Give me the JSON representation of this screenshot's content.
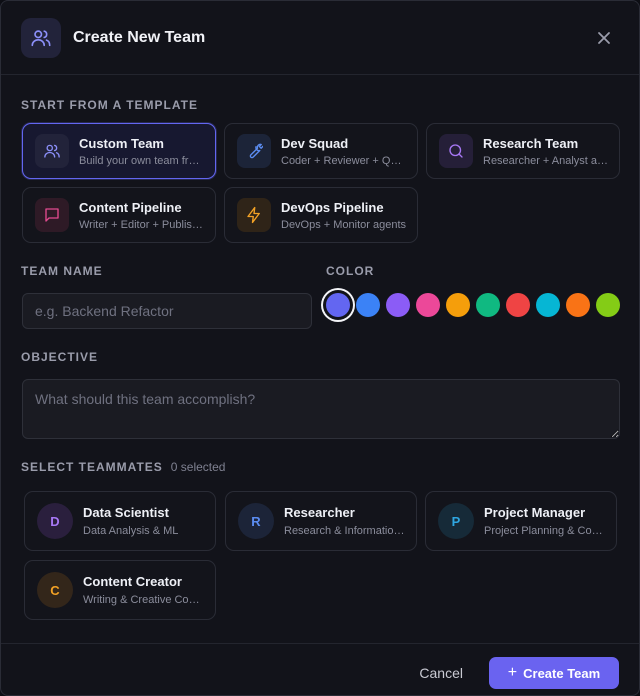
{
  "dialog": {
    "title": "Create New Team",
    "header_icon": "users-icon",
    "close_icon": "close-icon"
  },
  "templates": {
    "label": "START FROM A TEMPLATE",
    "items": [
      {
        "name": "Custom Team",
        "desc": "Build your own team from scratch",
        "icon": "users-icon",
        "color": "#8b8ff8",
        "bg": "#22233a",
        "selected": true
      },
      {
        "name": "Dev Squad",
        "desc": "Coder + Reviewer + QA Tester",
        "icon": "wrench-icon",
        "color": "#5b8cf0",
        "bg": "#1c2438"
      },
      {
        "name": "Research Team",
        "desc": "Researcher + Analyst agents",
        "icon": "search-icon",
        "color": "#a778f5",
        "bg": "#251f38"
      },
      {
        "name": "Content Pipeline",
        "desc": "Writer + Editor + Publisher",
        "icon": "chat-icon",
        "color": "#e24a8f",
        "bg": "#2e1a26"
      },
      {
        "name": "DevOps Pipeline",
        "desc": "DevOps + Monitor agents",
        "icon": "bolt-icon",
        "color": "#f2a125",
        "bg": "#2f2418"
      }
    ]
  },
  "team_name": {
    "label": "TEAM NAME",
    "placeholder": "e.g. Backend Refactor",
    "value": ""
  },
  "color": {
    "label": "COLOR",
    "options": [
      "#6366f1",
      "#3b82f6",
      "#8b5cf6",
      "#ec4899",
      "#f59e0b",
      "#10b981",
      "#ef4444",
      "#06b6d4",
      "#f97316",
      "#84cc16"
    ],
    "selected_index": 0
  },
  "objective": {
    "label": "OBJECTIVE",
    "placeholder": "What should this team accomplish?",
    "value": ""
  },
  "teammates": {
    "label": "SELECT TEAMMATES",
    "selected_count": "0 selected",
    "items": [
      {
        "initial": "D",
        "name": "Data Scientist",
        "role": "Data Analysis & ML",
        "color": "#a778f5",
        "bg": "#2a1f3d"
      },
      {
        "initial": "R",
        "name": "Researcher",
        "role": "Research & Information Gathering",
        "color": "#5b8cf0",
        "bg": "#1c2438"
      },
      {
        "initial": "P",
        "name": "Project Manager",
        "role": "Project Planning & Coordination",
        "color": "#2fa6e0",
        "bg": "#162a38"
      },
      {
        "initial": "C",
        "name": "Content Creator",
        "role": "Writing & Creative Content",
        "color": "#f2a125",
        "bg": "#33261a"
      }
    ]
  },
  "footer": {
    "cancel_label": "Cancel",
    "create_label": "Create Team",
    "create_icon": "plus-icon"
  }
}
